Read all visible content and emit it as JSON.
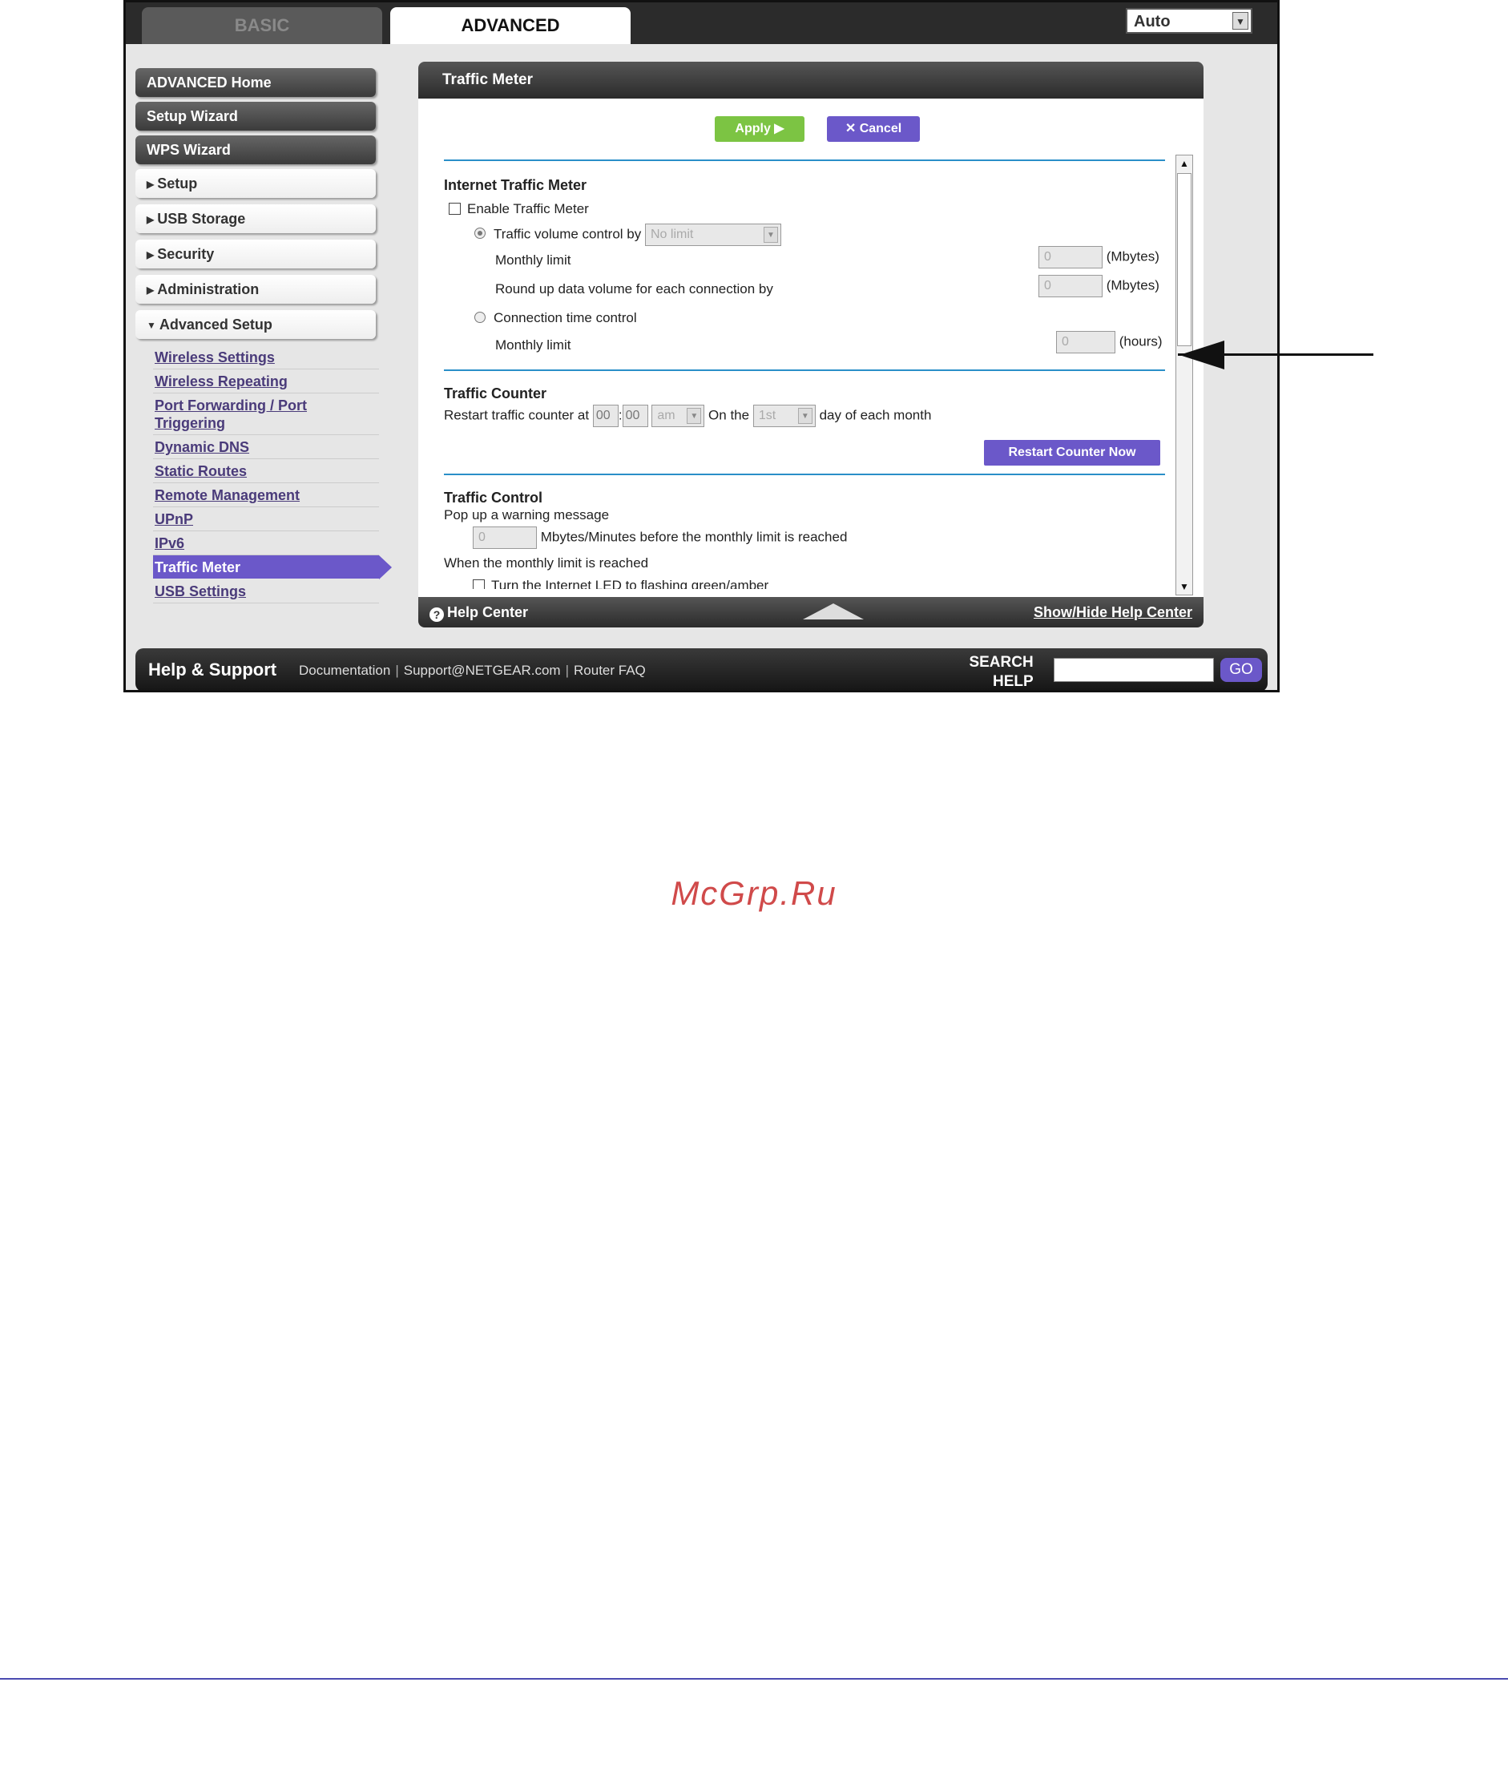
{
  "top": {
    "tabs": [
      {
        "label": "BASIC"
      },
      {
        "label": "ADVANCED"
      }
    ],
    "language": "Auto"
  },
  "sidebar": {
    "buttons": [
      {
        "label": "ADVANCED Home"
      },
      {
        "label": "Setup Wizard"
      },
      {
        "label": "WPS Wizard"
      }
    ],
    "sections": [
      {
        "label": "Setup"
      },
      {
        "label": "USB Storage"
      },
      {
        "label": "Security"
      },
      {
        "label": "Administration"
      },
      {
        "label": "Advanced Setup"
      }
    ],
    "sublinks": [
      {
        "label": "Wireless Settings"
      },
      {
        "label": "Wireless Repeating"
      },
      {
        "label": "Port Forwarding / Port Triggering"
      },
      {
        "label": "Dynamic DNS"
      },
      {
        "label": "Static Routes"
      },
      {
        "label": "Remote Management"
      },
      {
        "label": "UPnP"
      },
      {
        "label": "IPv6"
      },
      {
        "label": "Traffic Meter"
      },
      {
        "label": "USB Settings"
      }
    ]
  },
  "panel": {
    "title": "Traffic Meter",
    "apply_label": "Apply ▶",
    "cancel_label": "Cancel",
    "internet_meter": {
      "heading": "Internet Traffic Meter",
      "enable_label": "Enable Traffic Meter",
      "volume_label": "Traffic volume control by",
      "volume_value": "No limit",
      "monthly_limit_label": "Monthly limit",
      "monthly_limit_value": "0",
      "mbytes_unit": "(Mbytes)",
      "roundup_label": "Round up data volume for each connection by",
      "roundup_value": "0",
      "time_control_label": "Connection time control",
      "time_monthly_label": "Monthly limit",
      "time_monthly_value": "0",
      "hours_unit": "(hours)"
    },
    "counter": {
      "heading": "Traffic Counter",
      "restart_label": "Restart traffic counter at",
      "hour": "00",
      "colon": ":",
      "minute": "00",
      "ampm": "am",
      "on_the": "On the",
      "day": "1st",
      "day_suffix": "day of each month",
      "restart_now": "Restart Counter Now"
    },
    "control": {
      "heading": "Traffic Control",
      "popup_label": "Pop up a warning message",
      "warn_value": "0",
      "warn_suffix": "Mbytes/Minutes before the monthly limit is reached",
      "when_label": "When the monthly limit is reached",
      "led_label": "Turn the Internet LED to flashing green/amber"
    },
    "help_center": "Help Center",
    "show_hide": "Show/Hide Help Center"
  },
  "footer": {
    "title": "Help & Support",
    "links": [
      {
        "label": "Documentation"
      },
      {
        "label": "Support@NETGEAR.com"
      },
      {
        "label": "Router FAQ"
      }
    ],
    "search_line1": "SEARCH",
    "search_line2": "HELP",
    "go_label": "GO"
  },
  "watermark": "McGrp.Ru"
}
